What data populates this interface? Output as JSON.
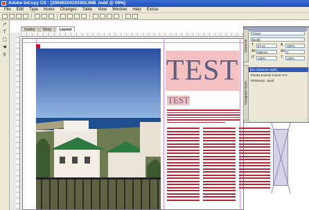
{
  "window": {
    "title": "Adobe InCopy CS - [20040204103303.INB .indd @ 59%]"
  },
  "menu": [
    "File",
    "Edit",
    "Type",
    "Notes",
    "Changes",
    "Table",
    "View",
    "Window",
    "Help",
    "Extras"
  ],
  "tabs": [
    {
      "label": "Galley",
      "active": false
    },
    {
      "label": "Story",
      "active": false
    },
    {
      "label": "Layout",
      "active": true
    }
  ],
  "document": {
    "headline": "TEST",
    "subhead": "TEST"
  },
  "panel": {
    "font_family": "Times",
    "font_style": "[Bold]",
    "size_value": "47 pt",
    "leading_value": "Metrics",
    "kerning_value": "0",
    "tracking_value": "100%",
    "scale_value": "100%",
    "side_tabs": [
      "Character",
      "Paragraph Styles"
    ],
    "styles_header": "[No character style]",
    "style_items": [
      "Plavka textový znacne 0-0",
      "Přehledný - Bold"
    ]
  },
  "colors": {
    "accent_pink": "#f4c1c3",
    "headline_color": "#5e5c7e",
    "text_red": "#c02838",
    "title_blue": "#1f4fb8"
  }
}
